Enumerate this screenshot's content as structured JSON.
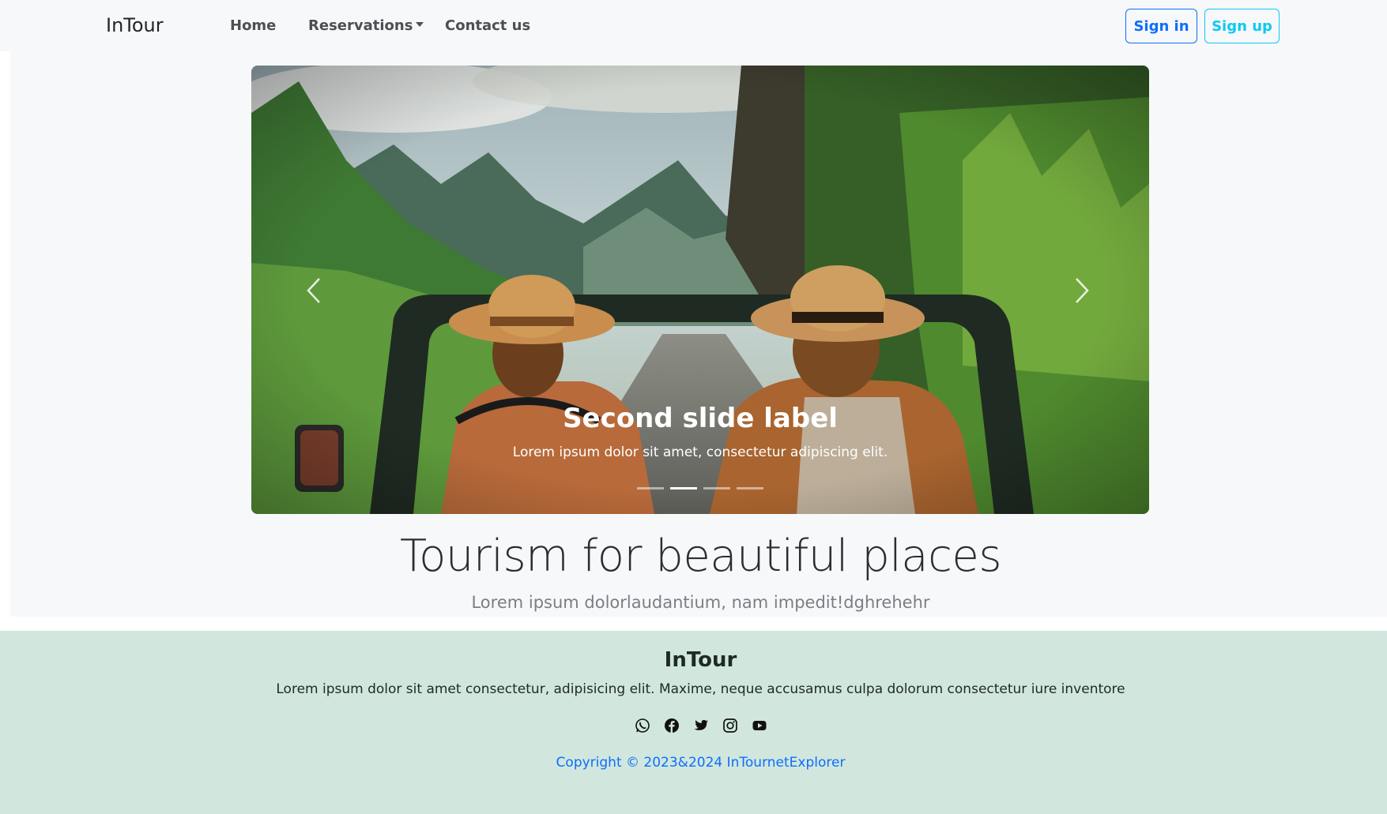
{
  "navbar": {
    "brand": "InTour",
    "links": {
      "home": "Home",
      "reservations": "Reservations",
      "contact": "Contact us"
    },
    "sign_in": "Sign in",
    "sign_up": "Sign up"
  },
  "carousel": {
    "caption_title": "Second slide label",
    "caption_text": "Lorem ipsum dolor sit amet, consectetur adipiscing elit.",
    "slide_count": 4,
    "active_index": 1,
    "prev_icon": "chevron-left-icon",
    "next_icon": "chevron-right-icon"
  },
  "hero": {
    "title": "Tourism for beautiful places",
    "subtitle": "Lorem ipsum dolorlaudantium, nam impedit!dghrehehr"
  },
  "footer": {
    "brand": "InTour",
    "text": "Lorem ipsum dolor sit amet consectetur, adipisicing elit. Maxime, neque accusamus culpa dolorum consectetur iure inventore",
    "socials": [
      "whatsapp-icon",
      "facebook-icon",
      "twitter-icon",
      "instagram-icon",
      "youtube-icon"
    ],
    "copyright": "Copyright © 2023&2024 InTournetExplorer"
  },
  "colors": {
    "primary": "#0d6efd",
    "info": "#0dcaf0",
    "footer_bg": "#d1e7dd",
    "page_bg": "#f7f8fa"
  }
}
